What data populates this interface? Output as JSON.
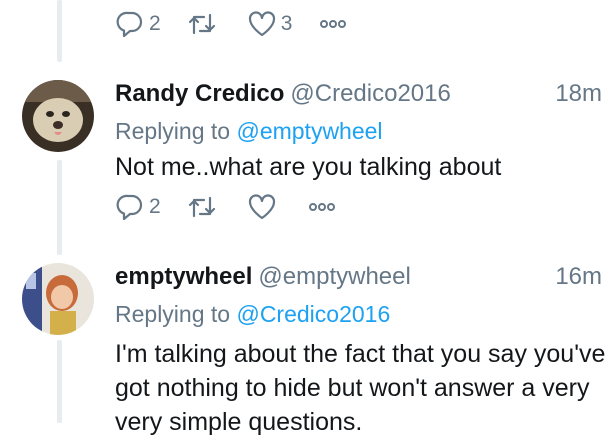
{
  "top_actions": {
    "reply_count": "2",
    "retweet_count": "",
    "like_count": "3"
  },
  "tweets": [
    {
      "name": "Randy Credico",
      "handle": "@Credico2016",
      "time": "18m",
      "replying_label": "Replying to",
      "replying_to": "@emptywheel",
      "text": "Not me..what are you talking about",
      "reply_count": "2",
      "retweet_count": "",
      "like_count": ""
    },
    {
      "name": "emptywheel",
      "handle": "@emptywheel",
      "time": "16m",
      "replying_label": "Replying to",
      "replying_to": "@Credico2016",
      "text": "I'm talking about the fact that you say you've got nothing to hide but won't answer a very very simple questions."
    }
  ]
}
